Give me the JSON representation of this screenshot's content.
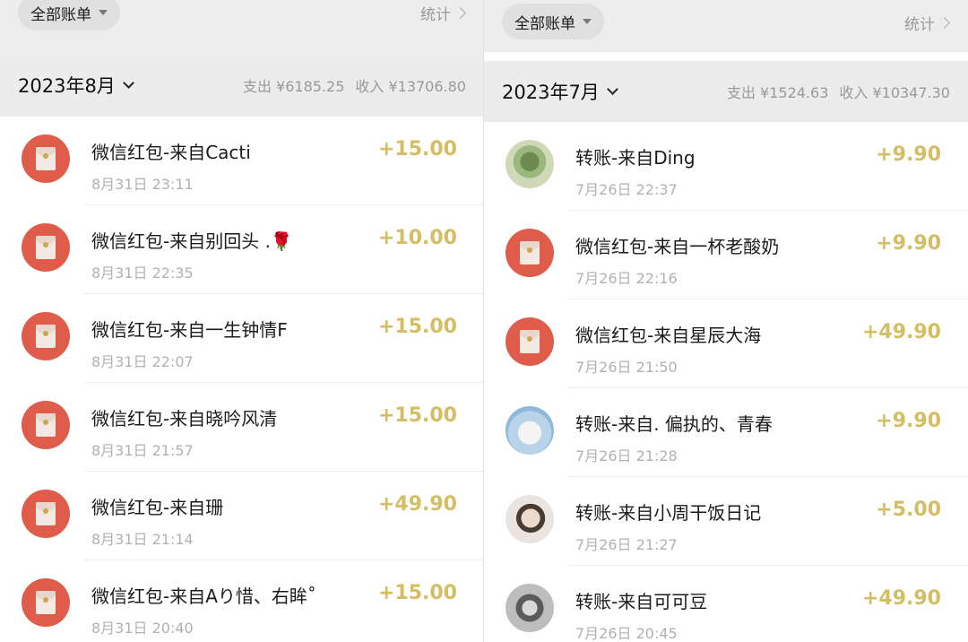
{
  "left": {
    "filter_label": "全部账单",
    "stats_label": "统计",
    "month_label": "2023年8月",
    "expense_label": "支出 ¥6185.25",
    "income_label": "收入 ¥13706.80",
    "items": [
      {
        "title": "微信红包-来自Cacti",
        "time": "8月31日 23:11",
        "amount": "+15.00",
        "icon": "red-envelope-icon"
      },
      {
        "title": "微信红包-来自别回头 .🌹",
        "time": "8月31日 22:35",
        "amount": "+10.00",
        "icon": "red-envelope-icon"
      },
      {
        "title": "微信红包-来自一生钟情F",
        "time": "8月31日 22:07",
        "amount": "+15.00",
        "icon": "red-envelope-icon"
      },
      {
        "title": "微信红包-来自晓吟风清",
        "time": "8月31日 21:57",
        "amount": "+15.00",
        "icon": "red-envelope-icon"
      },
      {
        "title": "微信红包-来自珊",
        "time": "8月31日 21:14",
        "amount": "+49.90",
        "icon": "red-envelope-icon"
      },
      {
        "title": "微信红包-来自Aり惜、右眸˚",
        "time": "8月31日 20:40",
        "amount": "+15.00",
        "icon": "red-envelope-icon"
      }
    ]
  },
  "right": {
    "filter_label": "全部账单",
    "stats_label": "统计",
    "month_label": "2023年7月",
    "expense_label": "支出 ¥1524.63",
    "income_label": "收入 ¥10347.30",
    "items": [
      {
        "title": "转账-来自Ding",
        "time": "7月26日 22:37",
        "amount": "+9.90",
        "icon": "user-avatar"
      },
      {
        "title": "微信红包-来自一杯老酸奶",
        "time": "7月26日 22:16",
        "amount": "+9.90",
        "icon": "red-envelope-icon"
      },
      {
        "title": "微信红包-来自星辰大海",
        "time": "7月26日 21:50",
        "amount": "+49.90",
        "icon": "red-envelope-icon"
      },
      {
        "title": "转账-来自. 偏执的、青春",
        "time": "7月26日 21:28",
        "amount": "+9.90",
        "icon": "user-avatar"
      },
      {
        "title": "转账-来自小周干饭日记",
        "time": "7月26日 21:27",
        "amount": "+5.00",
        "icon": "user-avatar"
      },
      {
        "title": "转账-来自可可豆",
        "time": "7月26日 20:45",
        "amount": "+49.90",
        "icon": "user-avatar"
      }
    ]
  },
  "colors": {
    "amount": "#d4bd62",
    "red_envelope": "#e05c4a"
  }
}
